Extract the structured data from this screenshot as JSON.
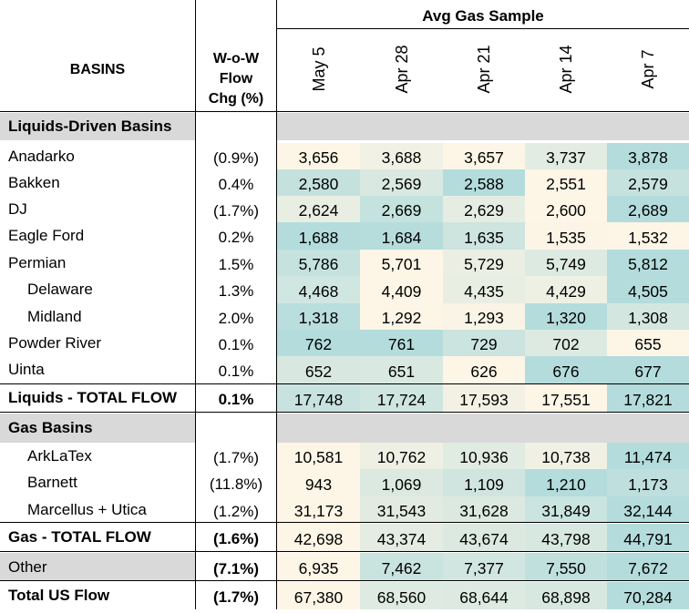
{
  "header": {
    "group_title": "Avg Gas Sample",
    "basins_label": "BASINS",
    "wow_label_lines": [
      "W-o-W",
      "Flow",
      "Chg (%)"
    ],
    "dates": [
      "May 5",
      "Apr 28",
      "Apr 21",
      "Apr 14",
      "Apr 7"
    ]
  },
  "colors": {
    "section_bg": "#d9d9d9",
    "low_cell": "#fdf5e6",
    "high_cell": "#b4dcdc",
    "rule": "#000000"
  },
  "chart_data": {
    "type": "table",
    "columns": [
      "BASINS",
      "W-o-W Flow Chg (%)",
      "May 5",
      "Apr 28",
      "Apr 21",
      "Apr 14",
      "Apr 7"
    ],
    "rows": [
      {
        "kind": "section",
        "label": "Liquids-Driven Basins"
      },
      {
        "kind": "data",
        "label": "Anadarko",
        "indent": false,
        "chg": "(0.9%)",
        "values": [
          "3,656",
          "3,688",
          "3,657",
          "3,737",
          "3,878"
        ]
      },
      {
        "kind": "data",
        "label": "Bakken",
        "indent": false,
        "chg": "0.4%",
        "values": [
          "2,580",
          "2,569",
          "2,588",
          "2,551",
          "2,579"
        ]
      },
      {
        "kind": "data",
        "label": "DJ",
        "indent": false,
        "chg": "(1.7%)",
        "values": [
          "2,624",
          "2,669",
          "2,629",
          "2,600",
          "2,689"
        ]
      },
      {
        "kind": "data",
        "label": "Eagle Ford",
        "indent": false,
        "chg": "0.2%",
        "values": [
          "1,688",
          "1,684",
          "1,635",
          "1,535",
          "1,532"
        ]
      },
      {
        "kind": "data",
        "label": "Permian",
        "indent": false,
        "chg": "1.5%",
        "values": [
          "5,786",
          "5,701",
          "5,729",
          "5,749",
          "5,812"
        ]
      },
      {
        "kind": "data",
        "label": "Delaware",
        "indent": true,
        "chg": "1.3%",
        "values": [
          "4,468",
          "4,409",
          "4,435",
          "4,429",
          "4,505"
        ]
      },
      {
        "kind": "data",
        "label": "Midland",
        "indent": true,
        "chg": "2.0%",
        "values": [
          "1,318",
          "1,292",
          "1,293",
          "1,320",
          "1,308"
        ]
      },
      {
        "kind": "data",
        "label": "Powder River",
        "indent": false,
        "chg": "0.1%",
        "values": [
          "762",
          "761",
          "729",
          "702",
          "655"
        ]
      },
      {
        "kind": "data",
        "label": "Uinta",
        "indent": false,
        "chg": "0.1%",
        "values": [
          "652",
          "651",
          "626",
          "676",
          "677"
        ]
      },
      {
        "kind": "total",
        "label": "Liquids - TOTAL FLOW",
        "chg": "0.1%",
        "values": [
          "17,748",
          "17,724",
          "17,593",
          "17,551",
          "17,821"
        ]
      },
      {
        "kind": "section",
        "label": "Gas Basins"
      },
      {
        "kind": "data",
        "label": "ArkLaTex",
        "indent": true,
        "chg": "(1.7%)",
        "values": [
          "10,581",
          "10,762",
          "10,936",
          "10,738",
          "11,474"
        ]
      },
      {
        "kind": "data",
        "label": "Barnett",
        "indent": true,
        "chg": "(11.8%)",
        "values": [
          "943",
          "1,069",
          "1,109",
          "1,210",
          "1,173"
        ]
      },
      {
        "kind": "data",
        "label": "Marcellus + Utica",
        "indent": true,
        "chg": "(1.2%)",
        "values": [
          "31,173",
          "31,543",
          "31,628",
          "31,849",
          "32,144"
        ]
      },
      {
        "kind": "total",
        "label": "Gas - TOTAL FLOW",
        "chg": "(1.6%)",
        "values": [
          "42,698",
          "43,374",
          "43,674",
          "43,798",
          "44,791"
        ]
      },
      {
        "kind": "other",
        "label": "Other",
        "chg": "(7.1%)",
        "values": [
          "6,935",
          "7,462",
          "7,377",
          "7,550",
          "7,672"
        ]
      },
      {
        "kind": "total",
        "label": "Total US Flow",
        "chg": "(1.7%)",
        "values": [
          "67,380",
          "68,560",
          "68,644",
          "68,898",
          "70,284"
        ]
      }
    ]
  }
}
